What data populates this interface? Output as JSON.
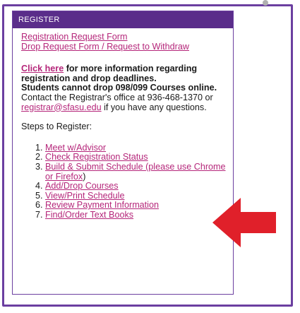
{
  "panel": {
    "header_title": "REGISTER",
    "links": [
      {
        "label": "Registration Request Form"
      },
      {
        "label": "Drop Request Form / Request to Withdraw"
      }
    ],
    "info": {
      "click_here": "Click here",
      "info_bold": " for more information regarding registration and drop deadlines.",
      "drop_note": "Students cannot drop 098/099 Courses online.",
      "contact_prefix": "Contact the Registrar's office at 936-468-1370 or ",
      "email": "registrar@sfasu.edu",
      "contact_suffix": " if you have any questions."
    },
    "steps_title": "Steps to Register:",
    "steps": [
      {
        "label": "Meet w/Advisor"
      },
      {
        "label": "Check Registration Status"
      },
      {
        "label": "Build & Submit Schedule (please use Chrome or Firefox",
        "suffix": ")"
      },
      {
        "label": "Add/Drop Courses"
      },
      {
        "label": "View/Print Schedule"
      },
      {
        "label": "Review Payment Information"
      },
      {
        "label": "Find/Order Text Books"
      }
    ]
  },
  "colors": {
    "header_bg": "#5a2d8a",
    "frame": "#6b3fa0",
    "link": "#b5267a",
    "arrow": "#e0202a"
  },
  "icons": {
    "arrow": "red-left-arrow-icon"
  }
}
